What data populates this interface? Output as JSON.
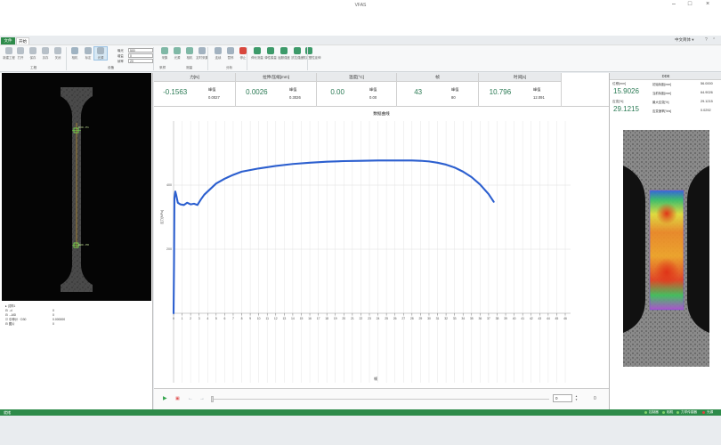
{
  "window": {
    "title": "VFAS",
    "help_icon": "help-icon",
    "minimize_icon": "minimize-icon",
    "maximize_icon": "maximize-icon",
    "close_icon": "close-icon"
  },
  "menu": {
    "file_tab": "文件",
    "start_tab": "开始",
    "language": "中文简体"
  },
  "ribbon": {
    "groups": [
      "工程",
      "设备",
      "采样",
      "测量",
      "分析"
    ],
    "buttons": [
      "新建工程",
      "打开",
      "保存",
      "另存",
      "关闭",
      "相机",
      "标定",
      "光源",
      "采集",
      "光源",
      "相机",
      "光源",
      "设备",
      "定时采集",
      "连续",
      "暂停",
      "停止",
      "伸长测量",
      "弹性模量",
      "屈服强度",
      "抗拉强度",
      "规定塑性延伸"
    ],
    "params": [
      {
        "label": "曝光",
        "value": "500"
      },
      {
        "label": "增益",
        "value": "0"
      },
      {
        "label": "帧率",
        "value": "20"
      }
    ]
  },
  "left_panel": {
    "gauge_labels": [
      "D30 - P1",
      "D30 - P8"
    ],
    "tree": [
      {
        "label": "▸ 试样1",
        "value": ""
      },
      {
        "label": "  ⊟ ..d",
        "value": "0"
      },
      {
        "label": "  ⊟ ...ASI",
        "value": "0"
      },
      {
        "label": "    ☑ 引伸计 · D30",
        "value": "0.000000"
      },
      {
        "label": "  ⊟ 图片",
        "value": "0"
      }
    ]
  },
  "metrics": [
    {
      "header": "力[N]",
      "value": "-0.1563",
      "peak_label": "峰值",
      "peak_value": "0.0027"
    },
    {
      "header": "拉伸/压缩[mm]",
      "value": "0.0026",
      "peak_label": "峰值",
      "peak_value": "0.3026"
    },
    {
      "header": "温度[°C]",
      "value": "0.00",
      "peak_label": "峰值",
      "peak_value": "0.00"
    },
    {
      "header": "帧",
      "value": "43",
      "peak_label": "峰值",
      "peak_value": "80"
    },
    {
      "header": "时间[s]",
      "value": "10.796",
      "peak_label": "峰值",
      "peak_value": "12.091"
    }
  ],
  "chart_title": "数据曲线",
  "chart_data": {
    "type": "line",
    "title": "数据曲线",
    "xlabel": "帧",
    "ylabel": "应力[MPa]",
    "xlim": [
      0,
      46
    ],
    "ylim": [
      0,
      600
    ],
    "x_ticks": [
      0,
      1,
      2,
      3,
      4,
      5,
      6,
      7,
      8,
      9,
      10,
      11,
      12,
      13,
      14,
      15,
      16,
      17,
      18,
      19,
      20,
      21,
      22,
      23,
      24,
      25,
      26,
      27,
      28,
      29,
      30,
      31,
      32,
      33,
      34,
      35,
      36,
      37,
      38,
      39,
      40,
      41,
      42,
      43,
      44,
      45,
      46
    ],
    "y_ticks": [
      200,
      400
    ],
    "grid": true,
    "series": [
      {
        "color": "#2c5fcf",
        "x": [
          0,
          0.05,
          0.1,
          0.2,
          0.3,
          0.5,
          0.8,
          1.2,
          1.6,
          2.0,
          2.4,
          2.8,
          3.2,
          3.6,
          4.0,
          5,
          6,
          7,
          8,
          10,
          12,
          14,
          16,
          18,
          20,
          22,
          24,
          26,
          28,
          29,
          30,
          31,
          32,
          33,
          34,
          35,
          36,
          37,
          37.6
        ],
        "y": [
          0,
          150,
          360,
          380,
          370,
          345,
          340,
          338,
          345,
          340,
          342,
          338,
          355,
          370,
          380,
          405,
          420,
          432,
          442,
          452,
          460,
          466,
          470,
          473,
          475,
          476,
          477,
          477,
          477,
          476,
          474,
          470,
          464,
          455,
          442,
          425,
          402,
          372,
          348
        ]
      }
    ]
  },
  "playback": {
    "frame_value": "0",
    "frame_total": "0"
  },
  "right_panel": {
    "header": "DDE",
    "big_metrics": [
      {
        "label": "位移[mm]",
        "value": "15.9026"
      },
      {
        "label": "应变[%]",
        "value": "29.1215"
      }
    ],
    "small_metrics": [
      {
        "label": "初始标距[mm]",
        "value": "56.0000"
      },
      {
        "label": "当前标距[mm]",
        "value": "64.9026"
      },
      {
        "label": "最大应变[%]",
        "value": "29.1215"
      },
      {
        "label": "应变速率[%/s]",
        "value": "0.0292"
      }
    ]
  },
  "statusbar": {
    "left_text": "就绪",
    "indicators": [
      {
        "label": "控制器",
        "color": "#7fd36a"
      },
      {
        "label": "相机",
        "color": "#7fd36a"
      },
      {
        "label": "力学传感器",
        "color": "#7fd36a"
      },
      {
        "label": "光源",
        "color": "#e04040"
      }
    ]
  }
}
